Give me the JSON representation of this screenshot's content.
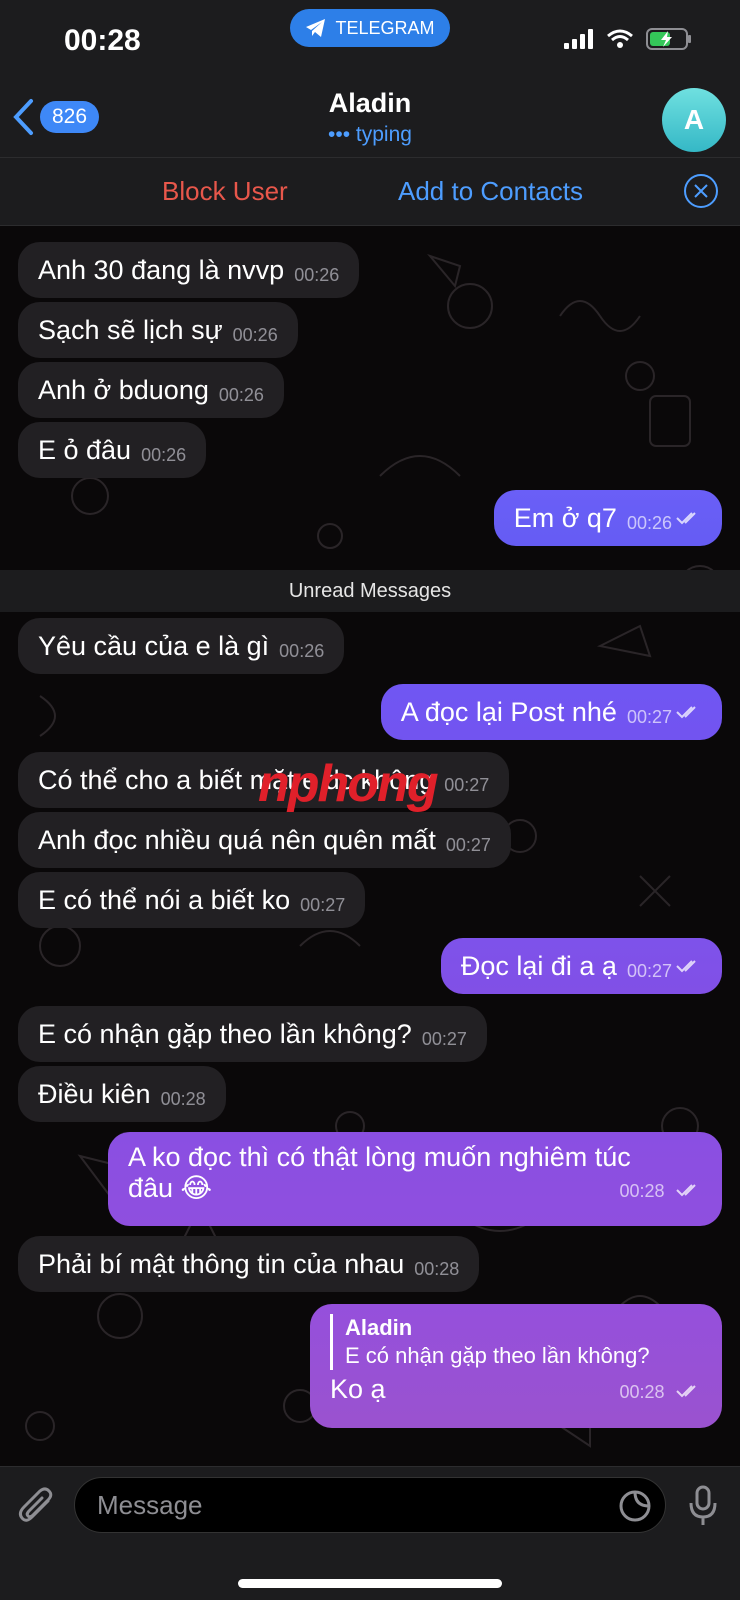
{
  "status_bar": {
    "time": "00:28",
    "app_pill": "TELEGRAM"
  },
  "header": {
    "back_count": "826",
    "title": "Aladin",
    "status": "typing",
    "avatar_letter": "A"
  },
  "action_bar": {
    "block_label": "Block User",
    "add_label": "Add to Contacts"
  },
  "messages": [
    {
      "dir": "in",
      "text": "Anh 30 đang là nvvp",
      "time": "00:26"
    },
    {
      "dir": "in",
      "text": "Sạch sẽ lịch sự",
      "time": "00:26"
    },
    {
      "dir": "in",
      "text": "Anh ở bduong",
      "time": "00:26"
    },
    {
      "dir": "in",
      "text": "E ỏ đâu",
      "time": "00:26"
    },
    {
      "dir": "out",
      "text": "Em ở q7",
      "time": "00:26"
    },
    {
      "dir": "in",
      "text": "Yêu cầu của e là gì",
      "time": "00:26"
    },
    {
      "dir": "out",
      "text": "A đọc lại Post nhé",
      "time": "00:27"
    },
    {
      "dir": "in",
      "text": "Có thể cho a biết mặt e dc không",
      "time": "00:27"
    },
    {
      "dir": "in",
      "text": "Anh đọc nhiều quá nên quên mất",
      "time": "00:27"
    },
    {
      "dir": "in",
      "text": "E có thể nói a biết ko",
      "time": "00:27"
    },
    {
      "dir": "out",
      "text": "Đọc lại đi a ạ",
      "time": "00:27"
    },
    {
      "dir": "in",
      "text": "E có nhận gặp theo lần không?",
      "time": "00:27"
    },
    {
      "dir": "in",
      "text": "Điều kiên",
      "time": "00:28"
    },
    {
      "dir": "out",
      "text_line1": "A ko đọc thì có thật lòng muốn nghiêm túc",
      "text_line2": "đâu 😂",
      "time": "00:28"
    },
    {
      "dir": "in",
      "text": "Phải bí mật thông tin của nhau",
      "time": "00:28"
    },
    {
      "dir": "out",
      "reply_author": "Aladin",
      "reply_text": "E có nhận gặp theo lần không?",
      "text": "Ko ạ",
      "time": "00:28"
    }
  ],
  "unread_label": "Unread Messages",
  "watermark": "nphong",
  "input": {
    "placeholder": "Message"
  },
  "colors": {
    "out_top": "#5b5cf5",
    "out_bottom": "#9a52cf",
    "incoming": "#222023",
    "accent": "#4d9dff",
    "danger": "#e8574b"
  }
}
